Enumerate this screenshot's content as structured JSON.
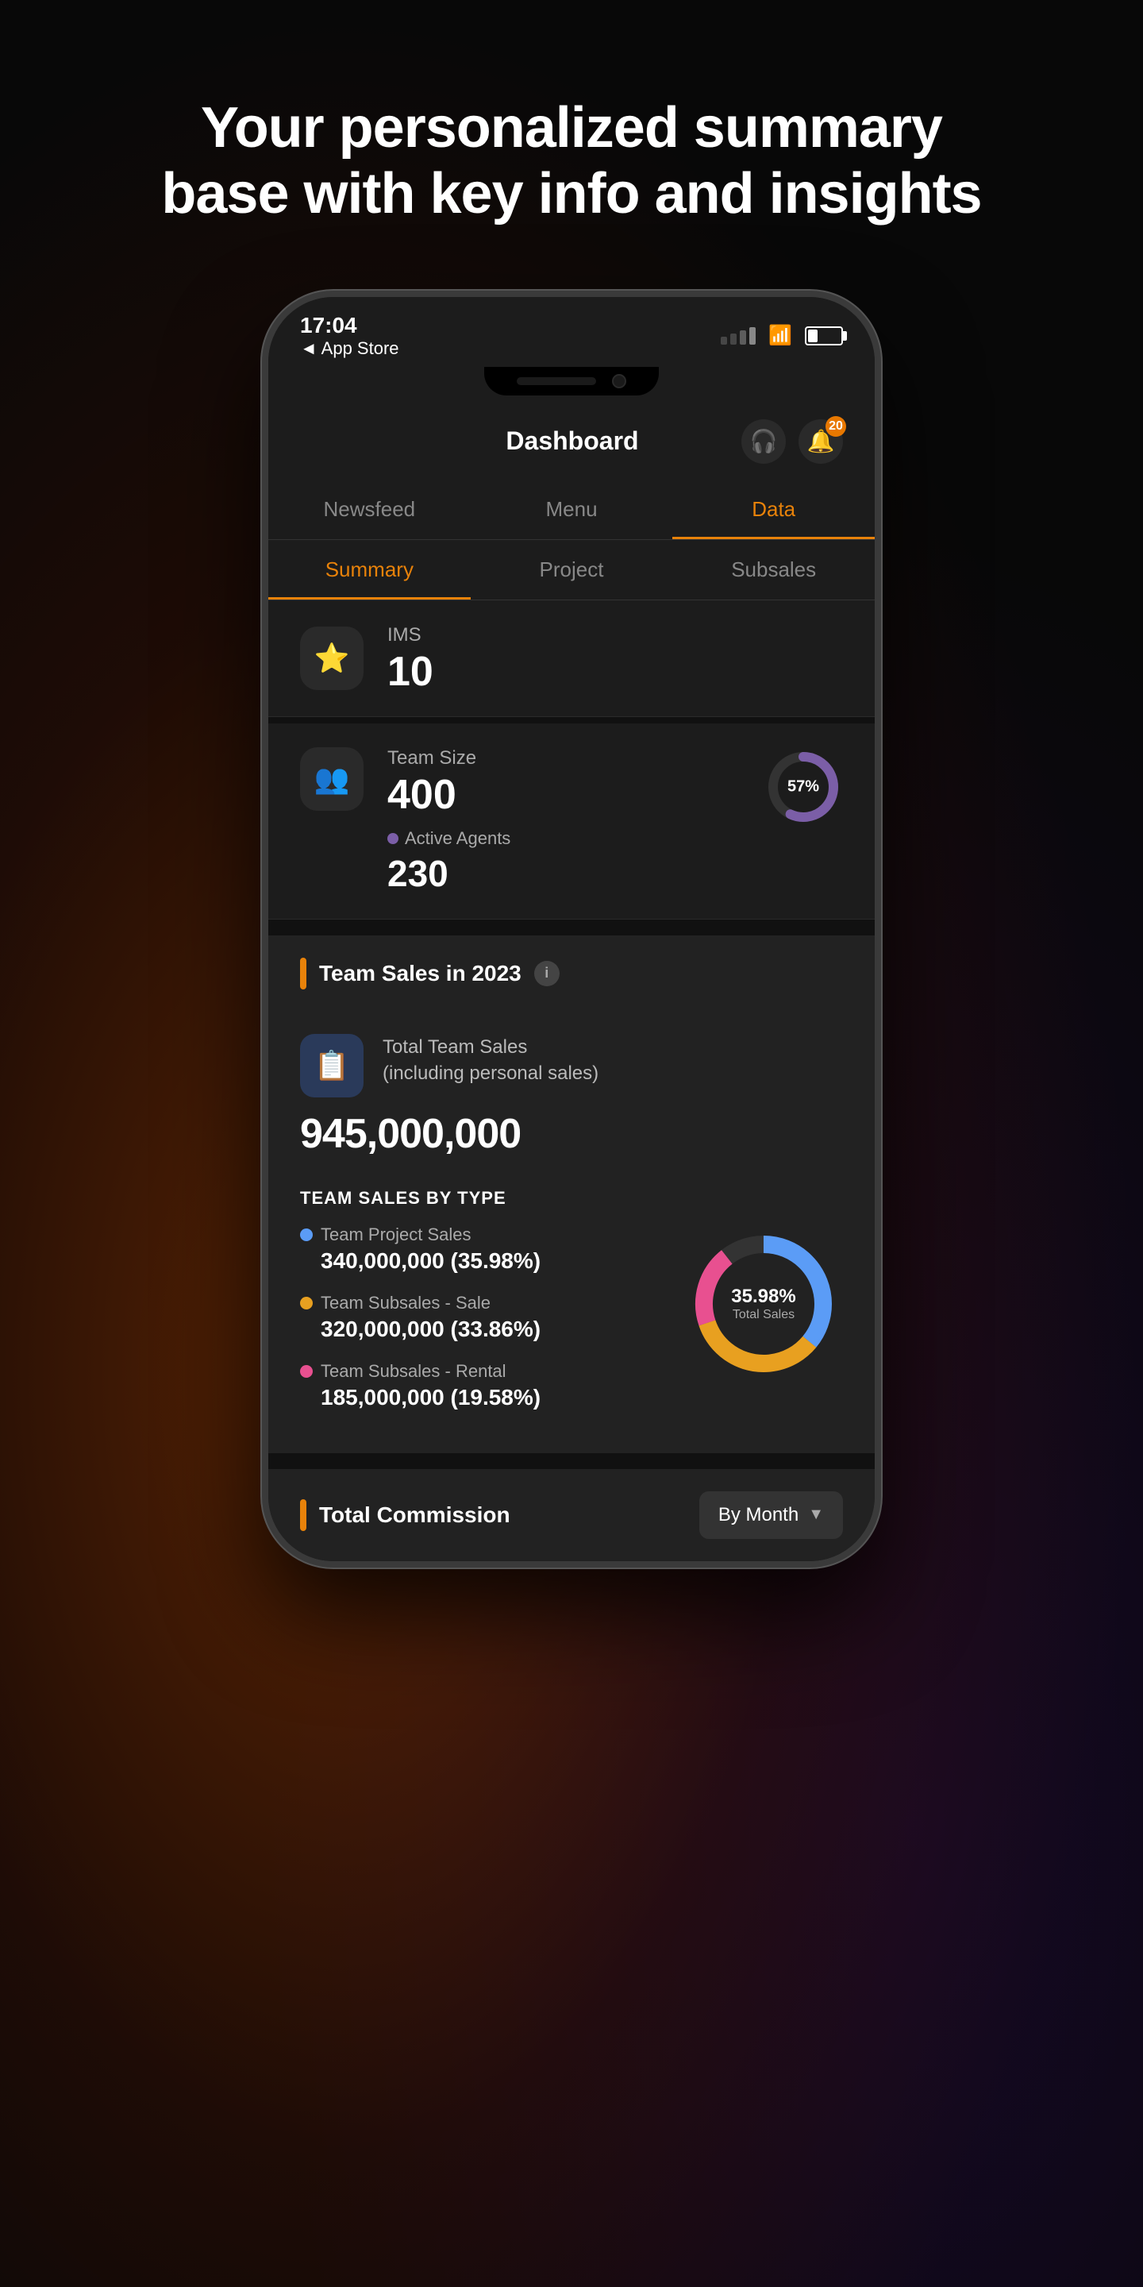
{
  "hero": {
    "text": "Your personalized summary base with key info and insights"
  },
  "status_bar": {
    "time": "17:04",
    "back_label": "◄ App Store",
    "battery_percent": 30
  },
  "nav": {
    "title": "Dashboard",
    "bell_count": "20"
  },
  "main_tabs": [
    {
      "label": "Newsfeed",
      "active": false
    },
    {
      "label": "Menu",
      "active": false
    },
    {
      "label": "Data",
      "active": true
    }
  ],
  "sub_tabs": [
    {
      "label": "Summary",
      "active": true
    },
    {
      "label": "Project",
      "active": false
    },
    {
      "label": "Subsales",
      "active": false
    }
  ],
  "ims": {
    "label": "IMS",
    "value": "10",
    "icon": "⭐"
  },
  "team_size": {
    "label": "Team Size",
    "value": "400",
    "active_label": "Active Agents",
    "active_value": "230",
    "active_percent": "57%",
    "active_percent_num": 57
  },
  "team_sales_section": {
    "title": "Team Sales in 2023"
  },
  "total_team_sales": {
    "label": "Total Team Sales\n(including personal sales)",
    "value": "945,000,000"
  },
  "sales_by_type": {
    "header": "TEAM SALES BY TYPE",
    "items": [
      {
        "label": "Team Project Sales",
        "value": "340,000,000 (35.98%)",
        "color": "#5B9CF6",
        "percent": 35.98
      },
      {
        "label": "Team Subsales - Sale",
        "value": "320,000,000 (33.86%)",
        "color": "#E8A020",
        "percent": 33.86
      },
      {
        "label": "Team Subsales - Rental",
        "value": "185,000,000 (19.58%)",
        "color": "#E85090",
        "percent": 19.58
      }
    ],
    "donut_center_percent": "35.98%",
    "donut_center_label": "Total Sales"
  },
  "total_commission": {
    "title": "Total Commission",
    "by_month_label": "By Month"
  },
  "icons": {
    "person": "👤",
    "group": "👥",
    "document": "📋",
    "bell": "🔔",
    "headset": "🎧"
  }
}
